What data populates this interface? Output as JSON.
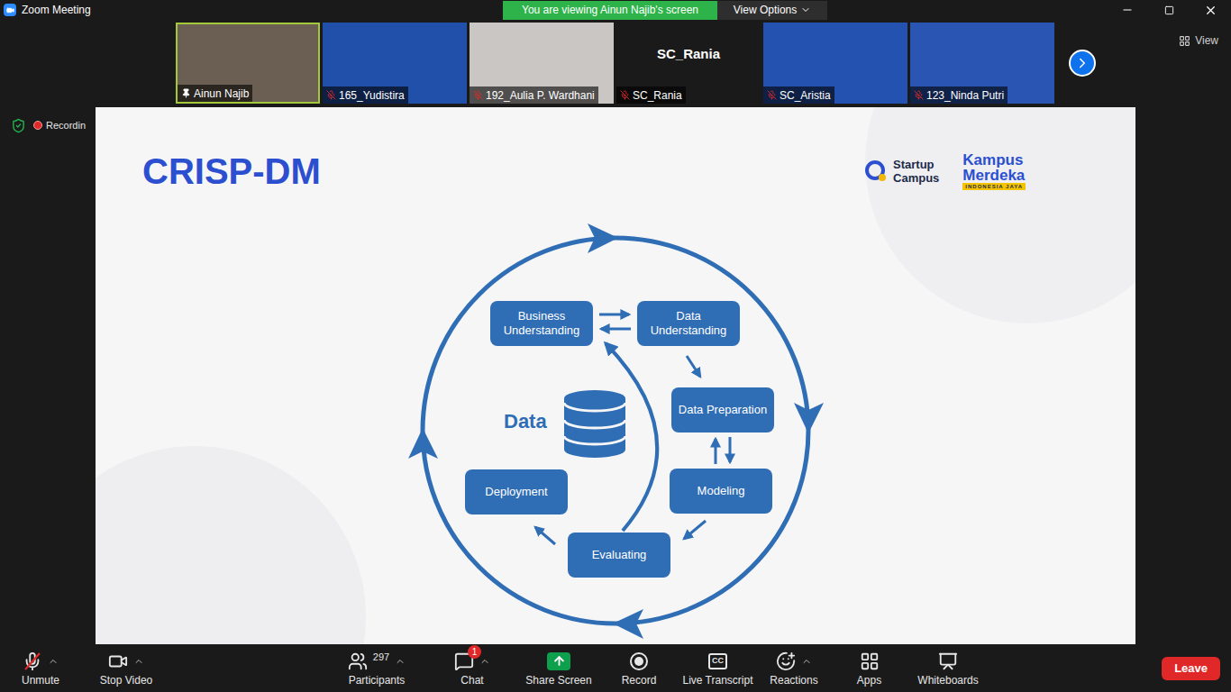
{
  "window": {
    "title": "Zoom Meeting"
  },
  "banner": {
    "text": "You are viewing Ainun Najib's screen",
    "view_options": "View Options"
  },
  "gallery": {
    "tiles": [
      {
        "name": "Ainun Najib",
        "kind": "video",
        "color": "#6b5e52",
        "muted": false,
        "pinned": true,
        "active": true
      },
      {
        "name": "165_Yudistira",
        "kind": "video",
        "color": "#2150aa",
        "muted": true,
        "pinned": false,
        "active": false
      },
      {
        "name": "192_Aulia P. Wardhani",
        "kind": "video",
        "color": "#c9c6c4",
        "muted": true,
        "pinned": false,
        "active": false
      },
      {
        "name": "SC_Rania",
        "kind": "name-only",
        "color": "#1a1a1a",
        "muted": true,
        "pinned": false,
        "active": false
      },
      {
        "name": "SC_Aristia",
        "kind": "video",
        "color": "#2352b0",
        "muted": true,
        "pinned": false,
        "active": false
      },
      {
        "name": "123_Ninda Putri",
        "kind": "video",
        "color": "#2a55b3",
        "muted": true,
        "pinned": false,
        "active": false
      }
    ],
    "view_label": "View"
  },
  "indicators": {
    "secure": true,
    "recording_label": "Recordin"
  },
  "slide": {
    "title": "CRISP-DM",
    "logos": {
      "startup_campus": [
        "Startup",
        "Campus"
      ],
      "kampus_merdeka": [
        "Kampus",
        "Merdeka"
      ],
      "kampus_merdeka_tag": "INDONESIA JAYA"
    },
    "diagram": {
      "center_label": "Data",
      "nodes": [
        {
          "label": "Business Understanding"
        },
        {
          "label": "Data Understanding"
        },
        {
          "label": "Data Preparation"
        },
        {
          "label": "Modeling"
        },
        {
          "label": "Evaluating"
        },
        {
          "label": "Deployment"
        }
      ]
    }
  },
  "toolbar": {
    "items": [
      {
        "label": "Unmute",
        "menu": true,
        "muted": true
      },
      {
        "label": "Stop Video",
        "menu": true
      },
      {
        "label": "Participants",
        "menu": true,
        "count": "297"
      },
      {
        "label": "Chat",
        "menu": true,
        "badge": "1"
      },
      {
        "label": "Share Screen",
        "menu": false
      },
      {
        "label": "Record",
        "menu": false
      },
      {
        "label": "Live Transcript",
        "menu": false,
        "icon_text": "CC"
      },
      {
        "label": "Reactions",
        "menu": true
      },
      {
        "label": "Apps",
        "menu": false
      },
      {
        "label": "Whiteboards",
        "menu": false
      }
    ],
    "leave": "Leave"
  }
}
